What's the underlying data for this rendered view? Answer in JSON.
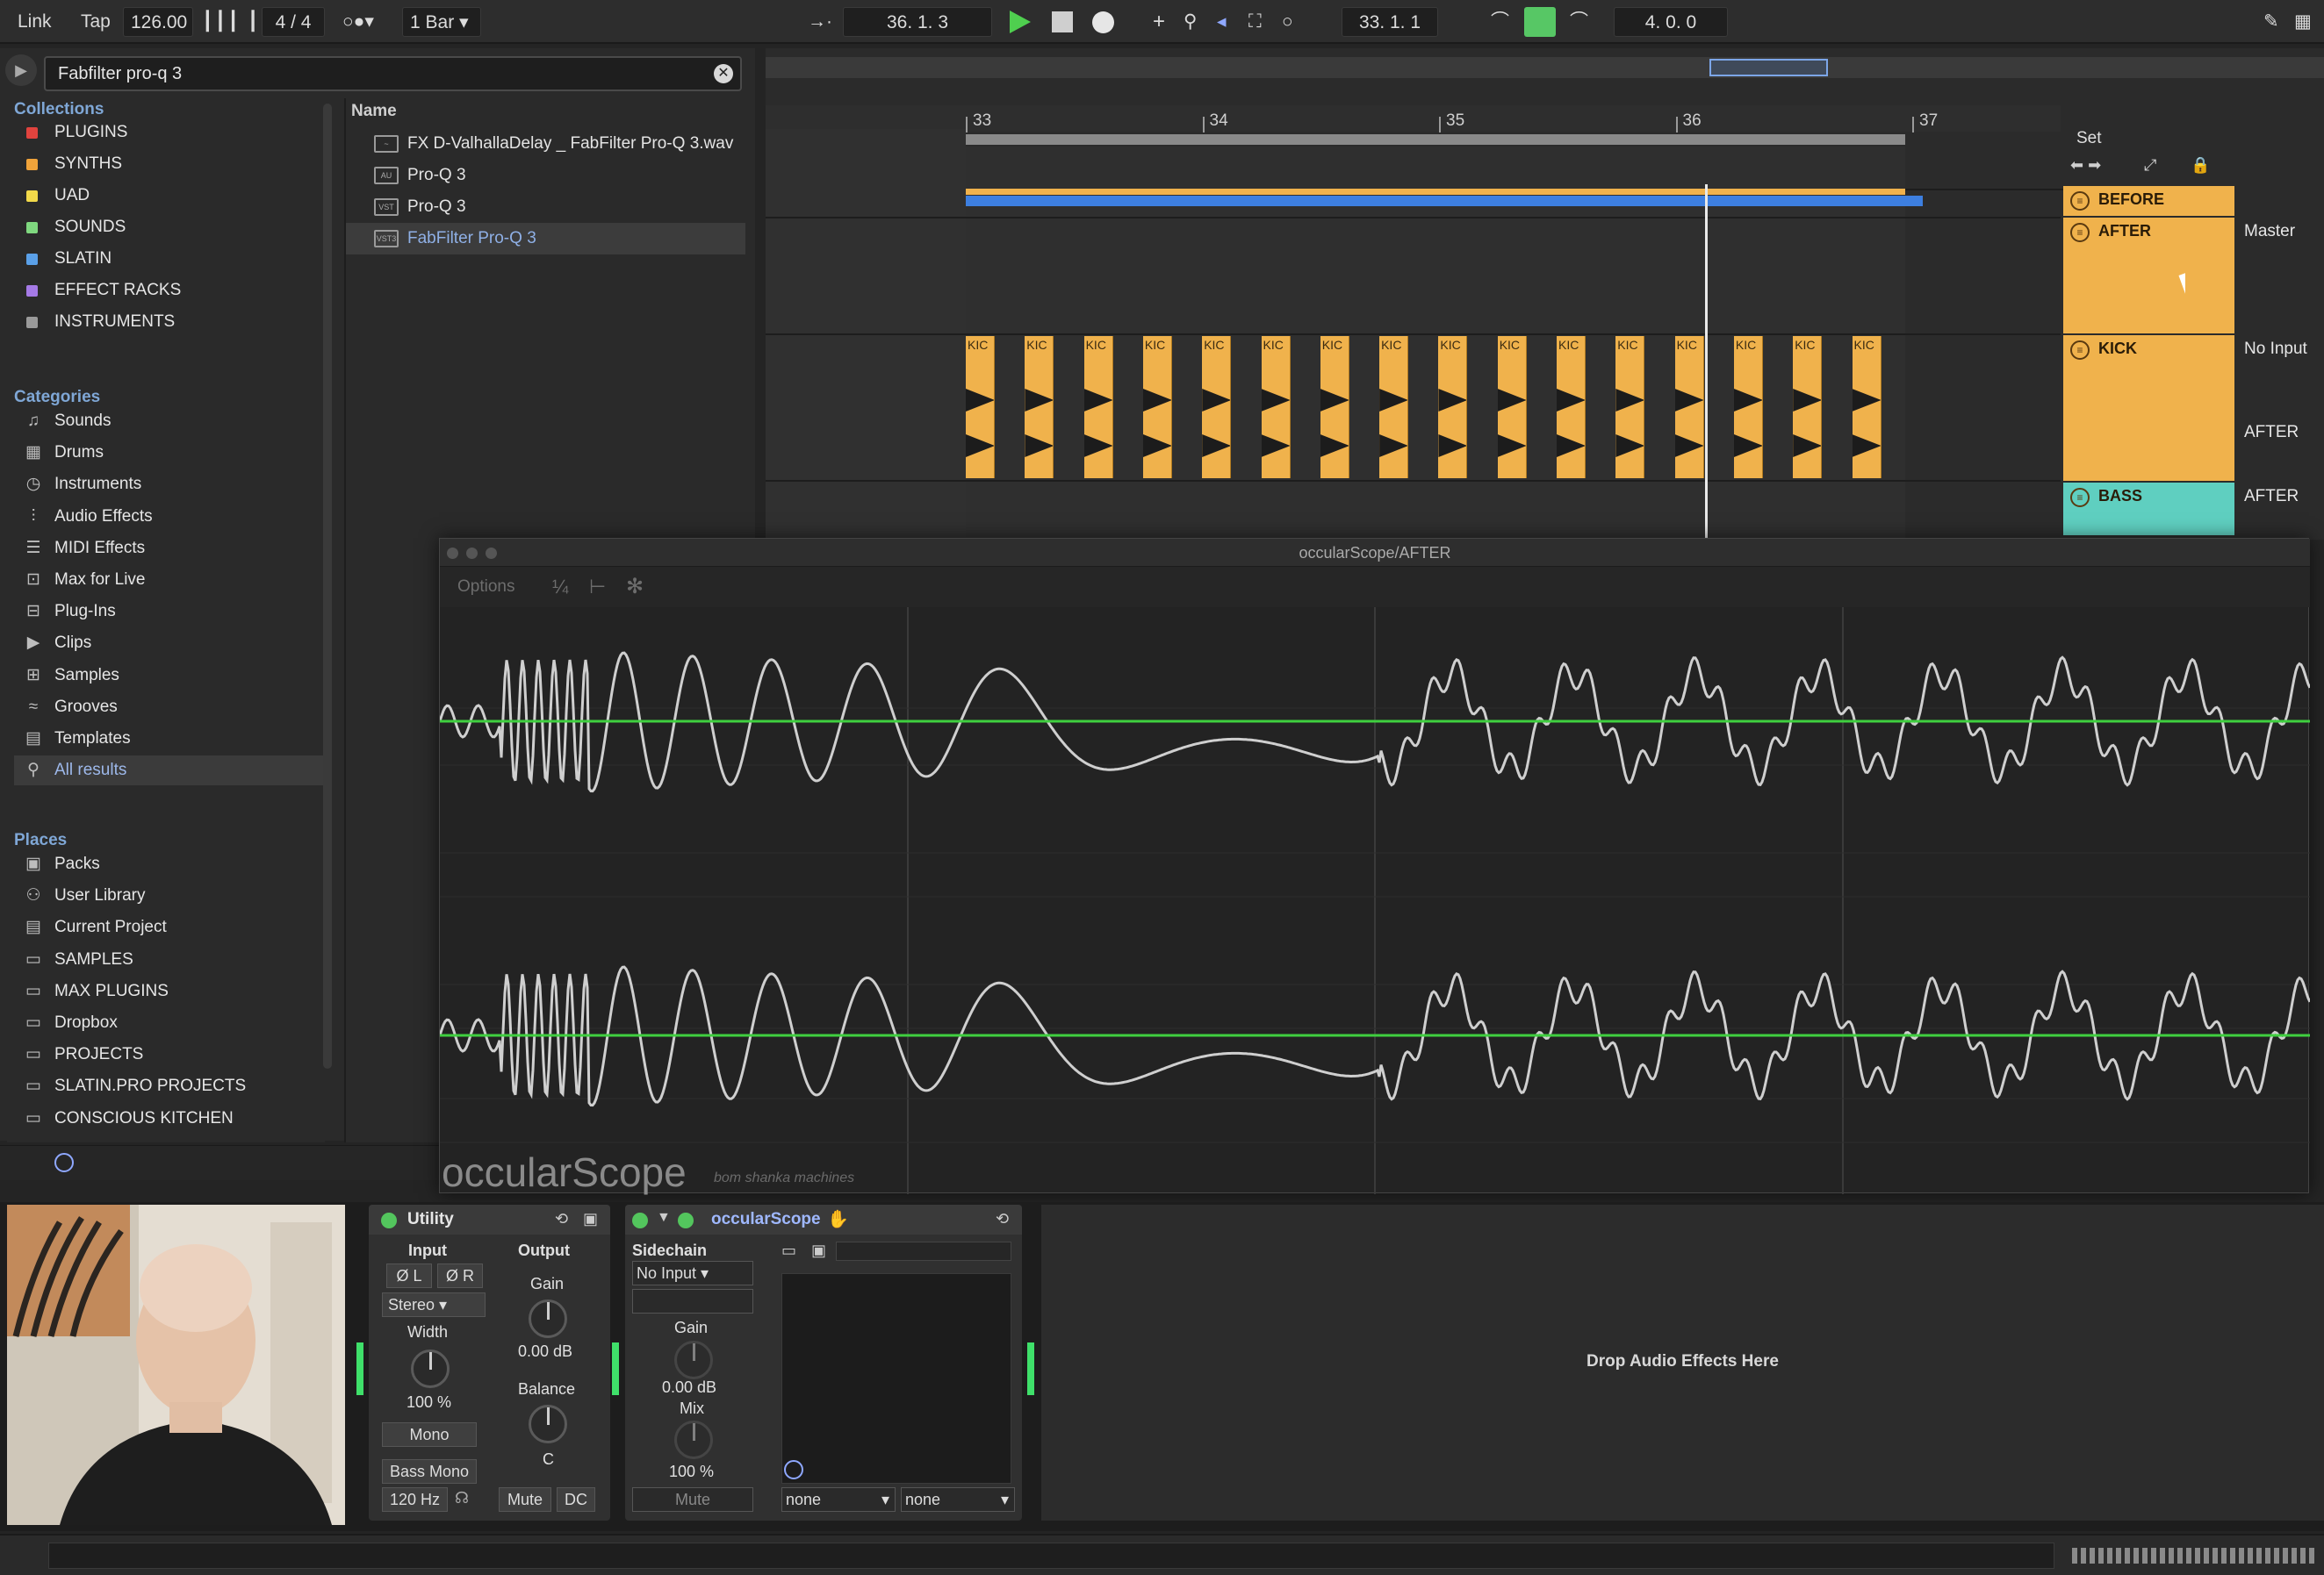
{
  "transport": {
    "link": "Link",
    "tap": "Tap",
    "tempo": "126.00",
    "signature": "4 / 4",
    "quantize": "1 Bar",
    "position": "36.  1.  3",
    "loop_start": "33.  1.  1",
    "loop_length": "4.  0.  0"
  },
  "browser": {
    "search_value": "Fabfilter pro-q 3",
    "collections_header": "Collections",
    "collections": [
      {
        "label": "PLUGINS",
        "color": "#e0433e"
      },
      {
        "label": "SYNTHS",
        "color": "#f0a33a"
      },
      {
        "label": "UAD",
        "color": "#f2d94a"
      },
      {
        "label": "SOUNDS",
        "color": "#7fd87f"
      },
      {
        "label": "SLATIN",
        "color": "#5aa0e8"
      },
      {
        "label": "EFFECT RACKS",
        "color": "#a57ae6"
      },
      {
        "label": "INSTRUMENTS",
        "color": "#9a9a9a"
      }
    ],
    "categories_header": "Categories",
    "categories": [
      {
        "label": "Sounds",
        "icon": "music-note-icon"
      },
      {
        "label": "Drums",
        "icon": "grid-icon"
      },
      {
        "label": "Instruments",
        "icon": "clock-icon"
      },
      {
        "label": "Audio Effects",
        "icon": "waveform-icon"
      },
      {
        "label": "MIDI Effects",
        "icon": "midi-icon"
      },
      {
        "label": "Max for Live",
        "icon": "max-icon"
      },
      {
        "label": "Plug-Ins",
        "icon": "plug-icon"
      },
      {
        "label": "Clips",
        "icon": "play-box-icon"
      },
      {
        "label": "Samples",
        "icon": "sample-icon"
      },
      {
        "label": "Grooves",
        "icon": "groove-icon"
      },
      {
        "label": "Templates",
        "icon": "template-icon"
      },
      {
        "label": "All results",
        "icon": "search-icon"
      }
    ],
    "places_header": "Places",
    "places": [
      {
        "label": "Packs",
        "icon": "packs-icon"
      },
      {
        "label": "User Library",
        "icon": "user-icon"
      },
      {
        "label": "Current Project",
        "icon": "project-icon"
      },
      {
        "label": "SAMPLES",
        "icon": "folder-icon"
      },
      {
        "label": "MAX PLUGINS",
        "icon": "folder-icon"
      },
      {
        "label": "Dropbox",
        "icon": "folder-icon"
      },
      {
        "label": "PROJECTS",
        "icon": "folder-icon"
      },
      {
        "label": "SLATIN.PRO PROJECTS",
        "icon": "folder-icon"
      },
      {
        "label": "CONSCIOUS KITCHEN",
        "icon": "folder-icon"
      }
    ],
    "name_header": "Name",
    "files": [
      {
        "label": "FX D-ValhallaDelay _ FabFilter Pro-Q 3.wav",
        "icon": "audio-file-icon"
      },
      {
        "label": "Pro-Q 3",
        "icon": "au-plugin-icon"
      },
      {
        "label": "Pro-Q 3",
        "icon": "vst-plugin-icon"
      },
      {
        "label": "FabFilter Pro-Q 3",
        "icon": "vst3-plugin-icon"
      }
    ]
  },
  "arrangement": {
    "bars": [
      "33",
      "34",
      "35",
      "36",
      "37"
    ],
    "set_label": "Set",
    "clip_label": "KIC",
    "tracks": [
      {
        "name": "BEFORE",
        "color": "#f0b24c",
        "io": ""
      },
      {
        "name": "AFTER",
        "color": "#f0b24c",
        "io": "Master"
      },
      {
        "name": "KICK",
        "color": "#f0b24c",
        "io": "No Input",
        "io2": "AFTER"
      },
      {
        "name": "BASS",
        "color": "#5fcfc0",
        "io": "AFTER"
      }
    ]
  },
  "scope": {
    "window_title": "occularScope/AFTER",
    "options": "Options",
    "brand": "occularScope",
    "brand_sub": "bom shanka machines",
    "trace_color": "#cfcfcf",
    "zero_line_color": "#3fcf3f"
  },
  "devices": {
    "utility": {
      "title": "Utility",
      "input": "Input",
      "output": "Output",
      "phase_l": "Ø L",
      "phase_r": "Ø R",
      "channel_mode": "Stereo",
      "gain_label": "Gain",
      "gain_value": "0.00 dB",
      "width_label": "Width",
      "width_value": "100 %",
      "mono": "Mono",
      "balance_label": "Balance",
      "balance_value": "C",
      "bass_mono": "Bass Mono",
      "bass_freq": "120 Hz",
      "mute": "Mute",
      "dc": "DC"
    },
    "scope": {
      "title": "occularScope",
      "sidechain": "Sidechain",
      "sidechain_input": "No Input",
      "gain_label": "Gain",
      "gain_value": "0.00 dB",
      "mix_label": "Mix",
      "mix_value": "100 %",
      "mute": "Mute",
      "select1": "none",
      "select2": "none"
    },
    "drop_hint": "Drop Audio Effects Here"
  }
}
